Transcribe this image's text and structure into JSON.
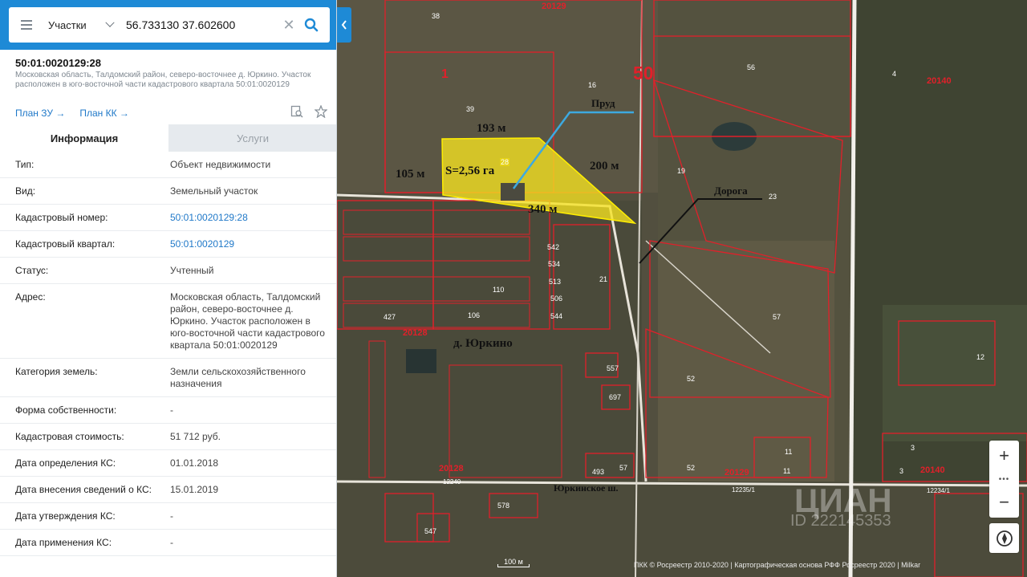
{
  "search": {
    "layer": "Участки",
    "query": "56.733130 37.602600"
  },
  "object": {
    "number": "50:01:0020129:28",
    "subtitle": "Московская область, Талдомский район, северо-восточнее д. Юркино. Участок расположен в юго-восточной части кадастрового квартала 50:01:0020129"
  },
  "plans": {
    "zu": "План ЗУ →",
    "kk": "План КК →"
  },
  "tabs": {
    "info": "Информация",
    "services": "Услуги"
  },
  "info": [
    {
      "k": "Тип:",
      "v": "Объект недвижимости"
    },
    {
      "k": "Вид:",
      "v": "Земельный участок"
    },
    {
      "k": "Кадастровый номер:",
      "v": "50:01:0020129:28"
    },
    {
      "k": "Кадастровый квартал:",
      "v": "50:01:0020129"
    },
    {
      "k": "Статус:",
      "v": "Учтенный"
    },
    {
      "k": "Адрес:",
      "v": "Московская область, Талдомский район, северо-восточнее д. Юркино. Участок расположен в юго-восточной части кадастрового квартала 50:01:0020129"
    },
    {
      "k": "Категория земель:",
      "v": "Земли сельскохозяйственного назначения"
    },
    {
      "k": "Форма собственности:",
      "v": "-"
    },
    {
      "k": "Кадастровая стоимость:",
      "v": "51 712 руб."
    },
    {
      "k": "Дата определения КС:",
      "v": "01.01.2018"
    },
    {
      "k": "Дата внесения сведений о КС:",
      "v": "15.01.2019"
    },
    {
      "k": "Дата утверждения КС:",
      "v": "-"
    },
    {
      "k": "Дата применения КС:",
      "v": "-"
    }
  ],
  "map": {
    "labels": {
      "side_193": "193 м",
      "side_105": "105 м",
      "area": "S=2,56 га",
      "side_200": "200 м",
      "side_340": "340 м",
      "pond": "Пруд",
      "road": "Дорога",
      "village": "д. Юркино",
      "highway": "Юркинское ш."
    },
    "region_number": "50",
    "quarters": [
      "20129",
      "20140",
      "20128",
      "20128",
      "20129",
      "20140"
    ],
    "plots": [
      "38",
      "1",
      "16",
      "39",
      "28",
      "56",
      "4",
      "19",
      "23",
      "21",
      "57",
      "52",
      "12",
      "52",
      "11",
      "11",
      "3",
      "3",
      "547",
      "578",
      "557",
      "697",
      "493",
      "57",
      "427",
      "110",
      "106",
      "542",
      "534",
      "513",
      "506",
      "544"
    ],
    "roads": [
      "12240",
      "12235/1",
      "12234/1"
    ],
    "zoom_in": "+",
    "zoom_out": "−",
    "zoom_more": "•••",
    "scale": "100 м",
    "attribution": "ПКК © Росреестр 2010-2020 | Картографическая основа РФФ Росреестр 2020 | Milkar",
    "watermark": "ЦИАН",
    "watermark_id": "ID 222145353"
  },
  "colors": {
    "accent": "#1e8ad6",
    "link": "#1f78c8",
    "boundary": "#e1202a",
    "highlight": "#ffe800"
  }
}
